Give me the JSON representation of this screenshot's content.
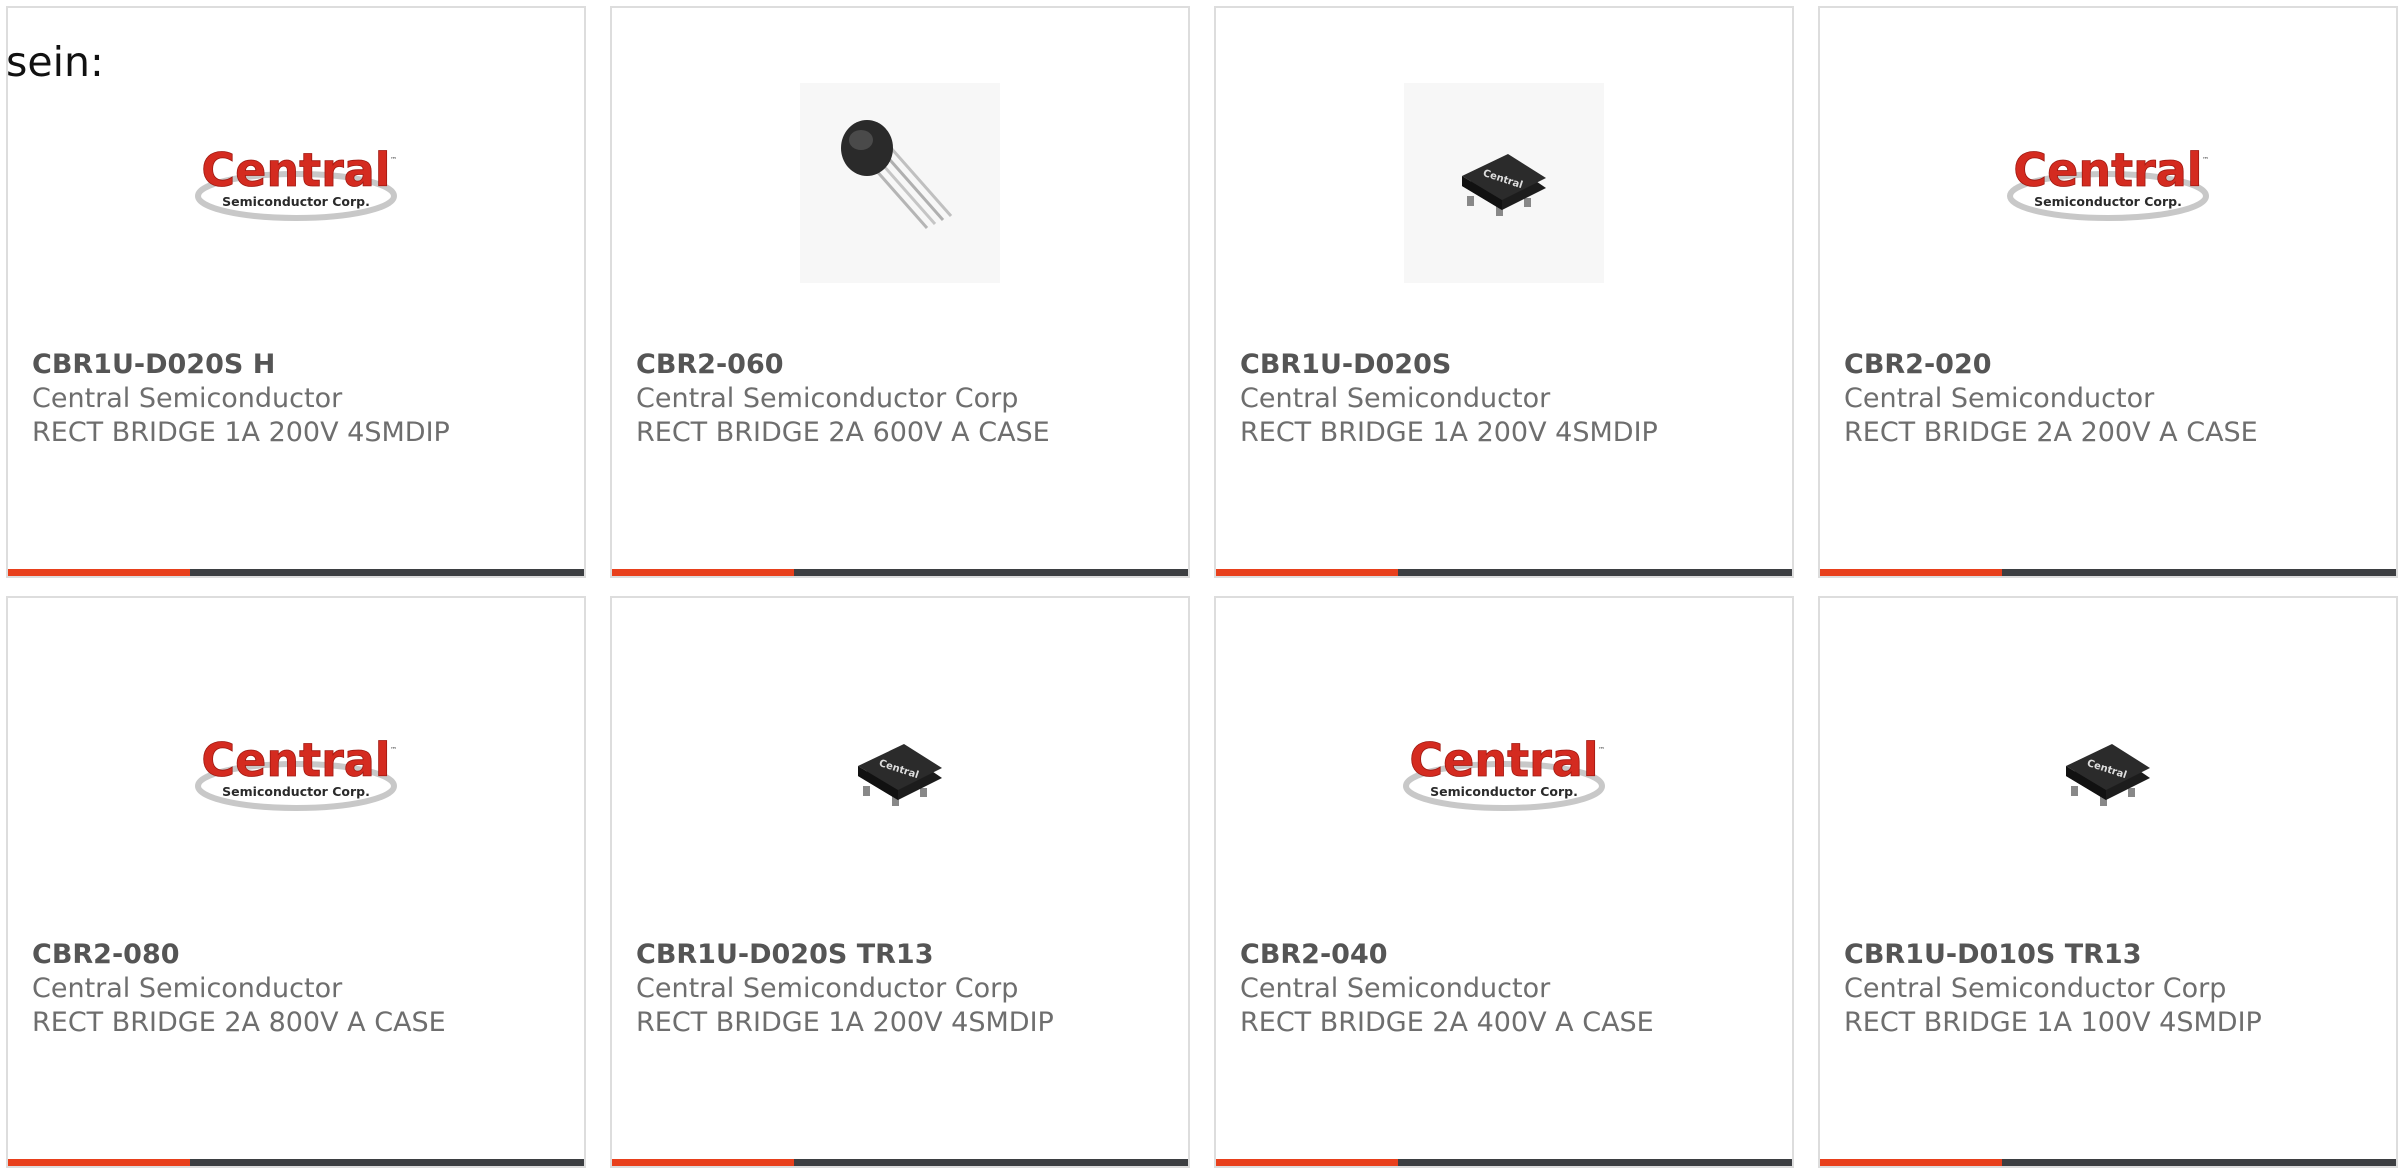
{
  "intro_text": "sein:",
  "colors": {
    "accent": "#e8401c",
    "bar": "#3d3f42",
    "border": "#dddddd",
    "logo_red": "#d42b20"
  },
  "products": [
    {
      "part": "CBR1U-D020S H",
      "manufacturer": "Central Semiconductor",
      "description": "RECT BRIDGE 1A 200V 4SMDIP",
      "image": "central-logo",
      "logo_text": "Central",
      "logo_subtext": "Semiconductor Corp."
    },
    {
      "part": "CBR2-060",
      "manufacturer": "Central Semiconductor Corp",
      "description": "RECT BRIDGE 2A 600V A CASE",
      "image": "round-case-component"
    },
    {
      "part": "CBR1U-D020S",
      "manufacturer": "Central Semiconductor",
      "description": "RECT BRIDGE 1A 200V 4SMDIP",
      "image": "smd-component"
    },
    {
      "part": "CBR2-020",
      "manufacturer": "Central Semiconductor",
      "description": "RECT BRIDGE 2A 200V A CASE",
      "image": "central-logo",
      "logo_text": "Central",
      "logo_subtext": "Semiconductor Corp."
    },
    {
      "part": "CBR2-080",
      "manufacturer": "Central Semiconductor",
      "description": "RECT BRIDGE 2A 800V A CASE",
      "image": "central-logo",
      "logo_text": "Central",
      "logo_subtext": "Semiconductor Corp."
    },
    {
      "part": "CBR1U-D020S TR13",
      "manufacturer": "Central Semiconductor Corp",
      "description": "RECT BRIDGE 1A 200V 4SMDIP",
      "image": "smd-component"
    },
    {
      "part": "CBR2-040",
      "manufacturer": "Central Semiconductor",
      "description": "RECT BRIDGE 2A 400V A CASE",
      "image": "central-logo",
      "logo_text": "Central",
      "logo_subtext": "Semiconductor Corp."
    },
    {
      "part": "CBR1U-D010S TR13",
      "manufacturer": "Central Semiconductor Corp",
      "description": "RECT BRIDGE 1A 100V 4SMDIP",
      "image": "smd-component"
    }
  ]
}
